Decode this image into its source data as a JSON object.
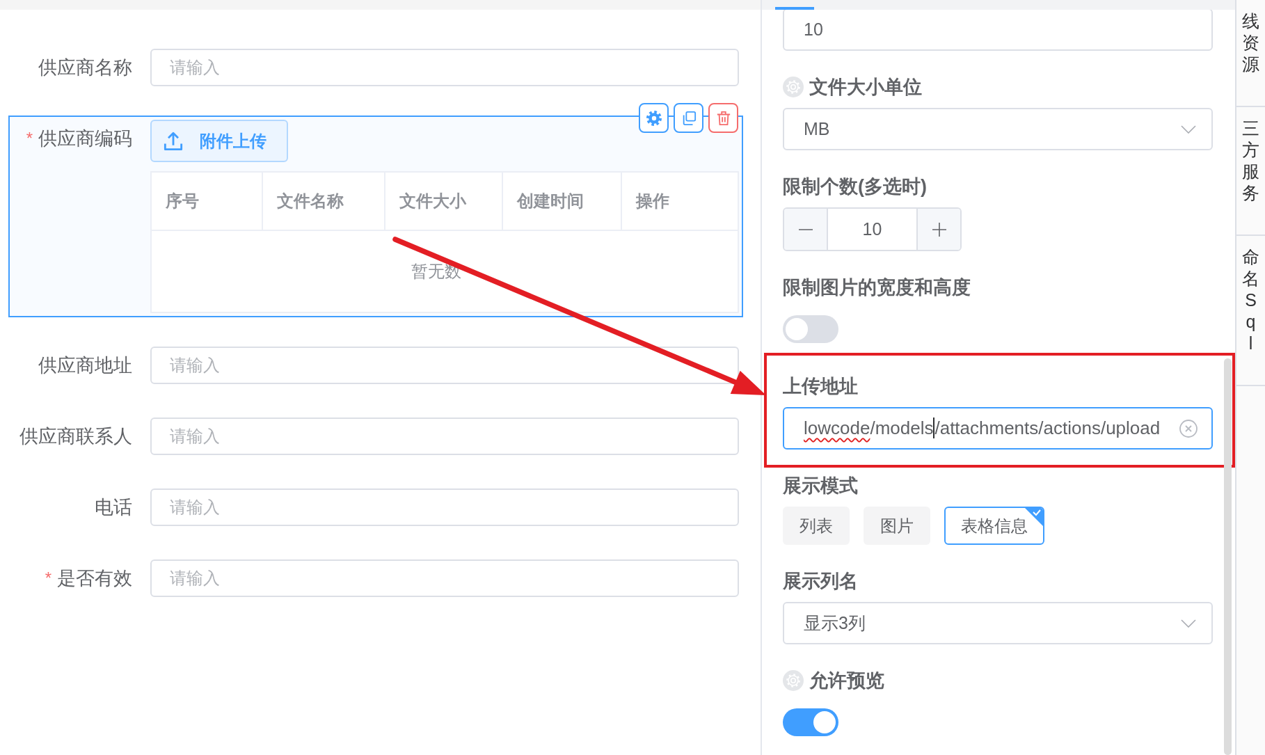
{
  "form": {
    "fields": [
      {
        "kind": "input",
        "label": "供应商名称",
        "placeholder": "请输入",
        "selected": false
      },
      {
        "kind": "upload",
        "label": "供应商编码",
        "required_mark": "*",
        "selected": true,
        "upload_button": "附件上传",
        "table": {
          "columns": [
            "序号",
            "文件名称",
            "文件大小",
            "创建时间",
            "操作"
          ],
          "empty_text": "暂无数"
        }
      },
      {
        "kind": "input",
        "label": "供应商地址",
        "placeholder": "请输入",
        "selected": false
      },
      {
        "kind": "input",
        "label": "供应商联系人",
        "placeholder": "请输入",
        "selected": false
      },
      {
        "kind": "input",
        "label": "电话",
        "placeholder": "请输入",
        "selected": false
      },
      {
        "kind": "input",
        "label": "是否有效",
        "required_mark": "*",
        "placeholder": "请输入",
        "selected": false
      }
    ]
  },
  "properties": {
    "items": [
      {
        "kind": "input",
        "value": "10",
        "focused": false,
        "clearable": false,
        "annotated": false
      },
      {
        "kind": "select",
        "label": "文件大小单位",
        "help_icon": true,
        "value": "MB",
        "focused": false,
        "annotated": false
      },
      {
        "kind": "number",
        "label": "限制个数(多选时)",
        "help_icon": false,
        "value": "10",
        "annotated": false
      },
      {
        "kind": "switch",
        "label": "限制图片的宽度和高度",
        "help_icon": false,
        "on": false,
        "annotated": false
      },
      {
        "kind": "input",
        "label": "上传地址",
        "help_icon": false,
        "focused": true,
        "clearable": true,
        "segments": [
          {
            "text": "lowcode",
            "misspelled": true,
            "caret": false
          },
          {
            "text": "/models",
            "misspelled": false,
            "caret": true
          },
          {
            "text": "/attachments/actions/upload",
            "misspelled": false,
            "caret": false
          }
        ],
        "annotated": true
      },
      {
        "kind": "radio",
        "label": "展示模式",
        "help_icon": false,
        "options": [
          {
            "label": "列表",
            "selected": false
          },
          {
            "label": "图片",
            "selected": false
          },
          {
            "label": "表格信息",
            "selected": true
          }
        ],
        "annotated": false
      },
      {
        "kind": "select",
        "label": "展示列名",
        "help_icon": false,
        "value": "显示3列",
        "focused": false,
        "annotated": false
      },
      {
        "kind": "switch",
        "label": "允许预览",
        "help_icon": true,
        "on": true,
        "annotated": false
      }
    ]
  },
  "side_tabs": [
    {
      "label": "线资源"
    },
    {
      "label": "三方服务"
    },
    {
      "label": "命名Sql"
    }
  ],
  "annotation_arrow": true
}
